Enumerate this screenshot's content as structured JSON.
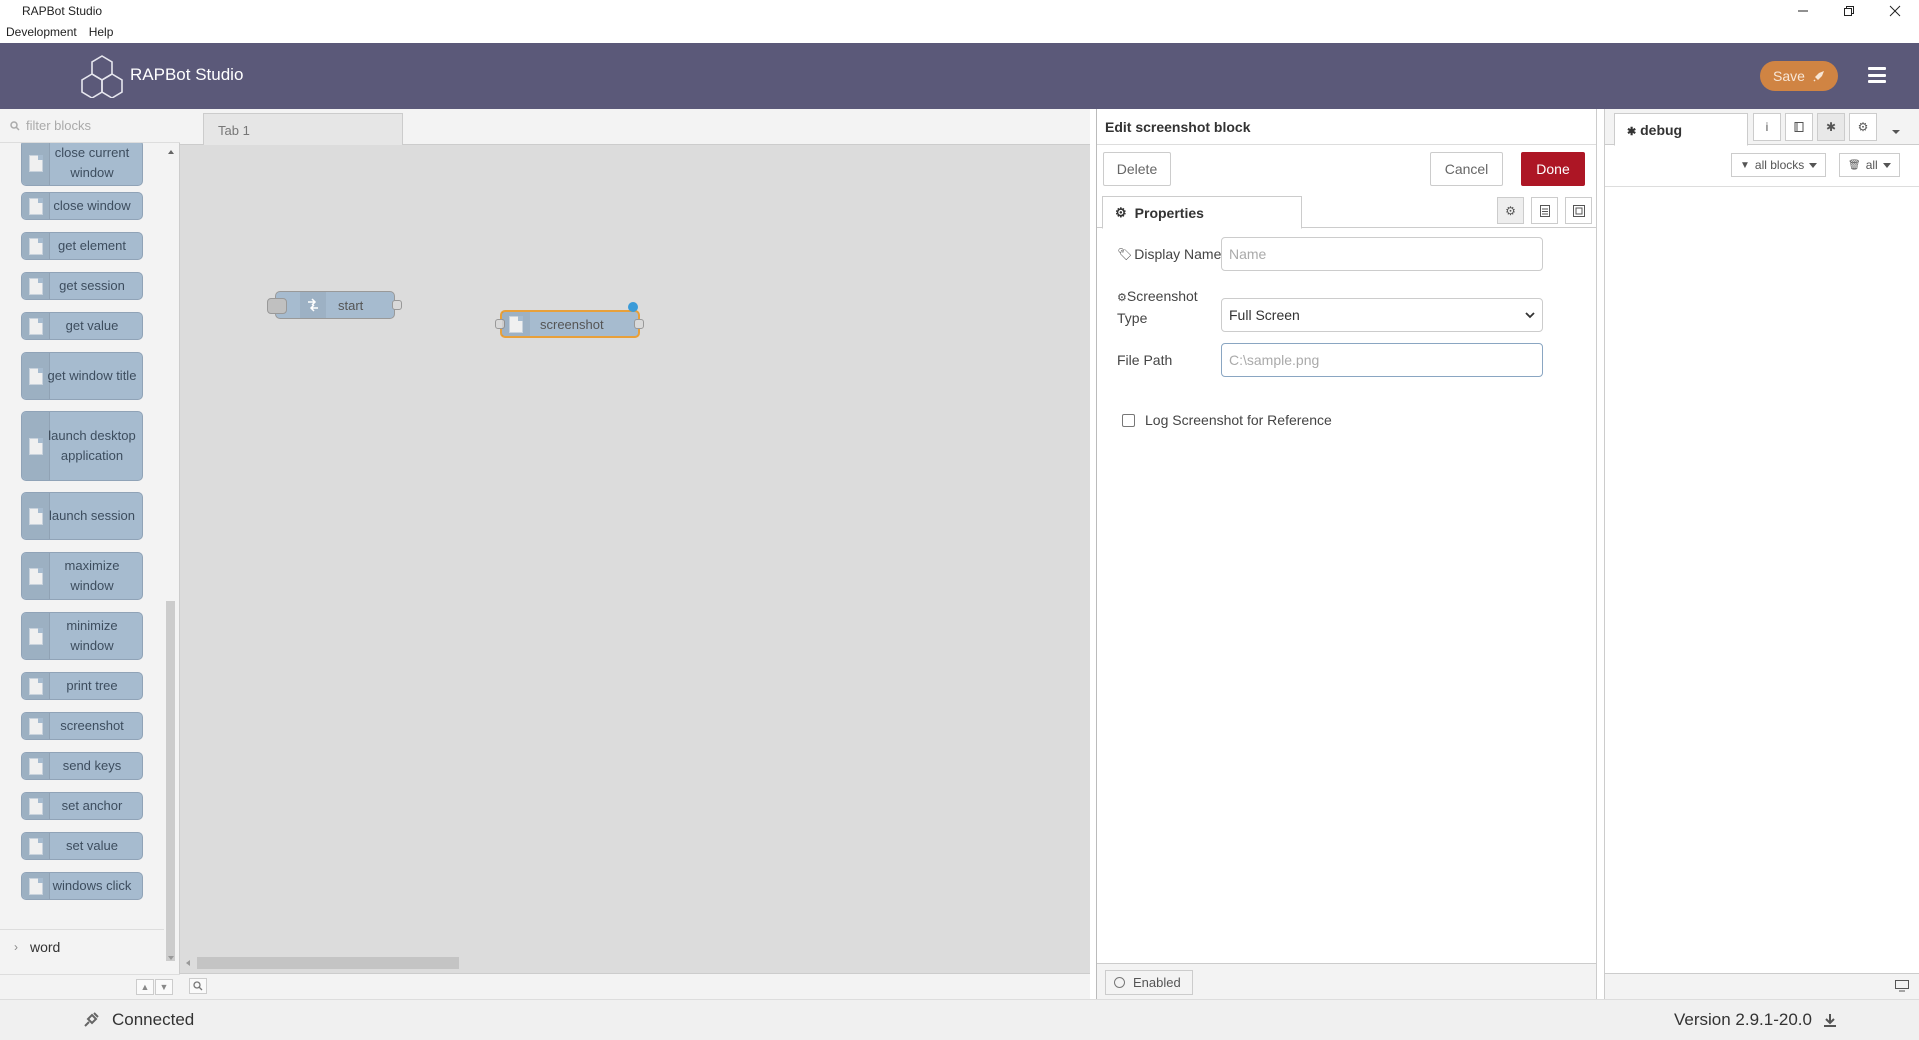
{
  "window": {
    "title": "RAPBot Studio",
    "menu": [
      "Development",
      "Help"
    ],
    "controls": [
      "minimize-icon",
      "restore-icon",
      "close-icon"
    ]
  },
  "header": {
    "brand": "RAPBot Studio",
    "save_label": "Save"
  },
  "palette": {
    "filter_placeholder": "filter blocks",
    "nodes": [
      "close current window",
      "close window",
      "get element",
      "get session",
      "get value",
      "get window title",
      "launch desktop application",
      "launch session",
      "maximize window",
      "minimize window",
      "print tree",
      "screenshot",
      "send keys",
      "set anchor",
      "set value",
      "windows click"
    ],
    "category": "word"
  },
  "workspace": {
    "tab": "Tab 1",
    "nodes": [
      "start",
      "screenshot"
    ]
  },
  "editor": {
    "title": "Edit screenshot block",
    "delete_label": "Delete",
    "cancel_label": "Cancel",
    "done_label": "Done",
    "properties_tab": "Properties",
    "display_name_label": "Display Name",
    "display_name_placeholder": "Name",
    "screenshot_type_label_1": "Screenshot",
    "screenshot_type_label_2": "Type",
    "screenshot_type_value": "Full Screen",
    "file_path_label": "File Path",
    "file_path_placeholder": "C:\\sample.png",
    "log_checkbox_label": "Log Screenshot for Reference",
    "enabled_label": "Enabled"
  },
  "sidebar": {
    "tab": "debug",
    "filter_blocks": "all blocks",
    "clear_label": "all"
  },
  "status": {
    "connection": "Connected",
    "version": "Version 2.9.1-20.0"
  },
  "colors": {
    "header": "#5b5979",
    "save": "#d08443",
    "done": "#ad1625",
    "node": "#a6bbcf",
    "selected_outline": "#ff7f0e"
  }
}
